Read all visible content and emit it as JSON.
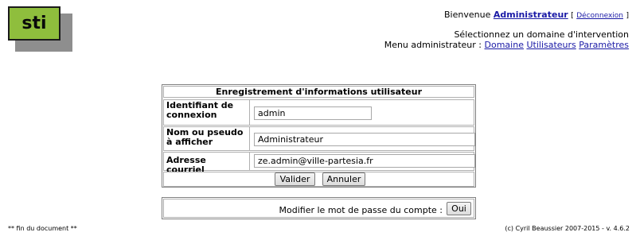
{
  "logo": {
    "text": "sti"
  },
  "header": {
    "welcome": "Bienvenue",
    "user": "Administrateur",
    "bracket_open": "[",
    "logout": "Déconnexion",
    "bracket_close": "]",
    "select_domain": "Sélectionnez un domaine d'intervention",
    "admin_menu_label": "Menu administrateur :",
    "menu_items": [
      "Domaine",
      "Utilisateurs",
      "Paramètres"
    ]
  },
  "form": {
    "title": "Enregistrement d'informations utilisateur",
    "fields": [
      {
        "label": "Identifiant de connexion",
        "value": "admin"
      },
      {
        "label": "Nom ou pseudo à afficher",
        "value": "Administrateur"
      },
      {
        "label": "Adresse courriel",
        "value": "ze.admin@ville-partesia.fr"
      }
    ],
    "buttons": {
      "validate": "Valider",
      "cancel": "Annuler"
    }
  },
  "password": {
    "label": "Modifier le mot de passe du compte :",
    "ok": "Oui"
  },
  "footer": {
    "left": "** fin du document **",
    "right": "(c) Cyril Beaussier 2007-2015 - v. 4.6.2"
  }
}
